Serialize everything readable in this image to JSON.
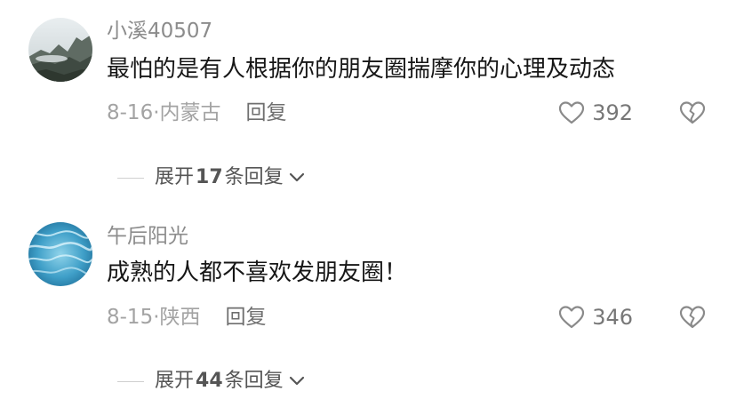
{
  "comments": [
    {
      "username": "小溪40507",
      "content": "最怕的是有人根据你的朋友圈揣摩你的心理及动态",
      "date": "8-16",
      "separator": "·",
      "location": "内蒙古",
      "reply_label": "回复",
      "likes": "392",
      "expand": {
        "prefix": "展开",
        "count": "17",
        "suffix": "条回复"
      }
    },
    {
      "username": "午后阳光",
      "content": "成熟的人都不喜欢发朋友圈！",
      "date": "8-15",
      "separator": "·",
      "location": "陕西",
      "reply_label": "回复",
      "likes": "346",
      "expand": {
        "prefix": "展开",
        "count": "44",
        "suffix": "条回复"
      }
    }
  ],
  "colors": {
    "text": "#161616",
    "muted": "#8c8c8c",
    "icon": "#888888"
  },
  "icons": [
    "mountain-avatar",
    "water-avatar",
    "heart-outline-icon",
    "broken-heart-icon",
    "chevron-down-icon"
  ]
}
